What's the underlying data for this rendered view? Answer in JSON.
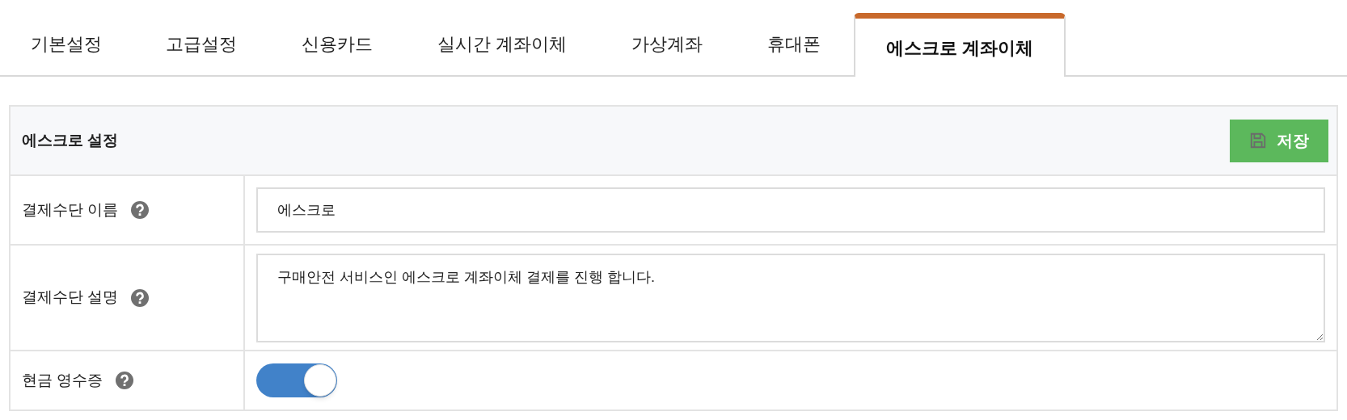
{
  "tabs": [
    {
      "label": "기본설정",
      "selected": false
    },
    {
      "label": "고급설정",
      "selected": false
    },
    {
      "label": "신용카드",
      "selected": false
    },
    {
      "label": "실시간 계좌이체",
      "selected": false
    },
    {
      "label": "가상계좌",
      "selected": false
    },
    {
      "label": "휴대폰",
      "selected": false
    },
    {
      "label": "에스크로 계좌이체",
      "selected": true
    }
  ],
  "panel": {
    "title": "에스크로 설정",
    "save_button": "저장",
    "rows": [
      {
        "kind": "input",
        "label": "결제수단 이름",
        "value": "에스크로"
      },
      {
        "kind": "textarea",
        "label": "결제수단 설명",
        "value": "구매안전 서비스인 에스크로 계좌이체 결제를 진행 합니다."
      },
      {
        "kind": "toggle",
        "label": "현금 영수증",
        "on": true
      }
    ]
  }
}
